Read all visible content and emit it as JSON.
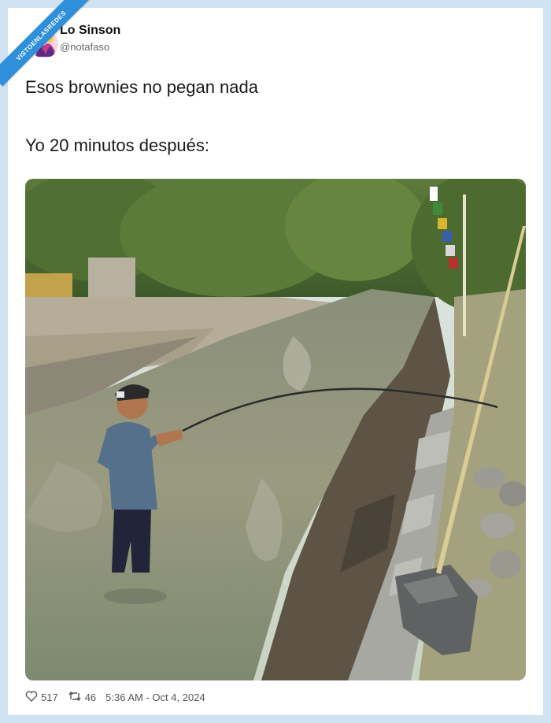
{
  "watermark": {
    "text": "VISTOENLASREDES"
  },
  "tweet": {
    "author_name": "Lo Sinson",
    "author_handle": "@notafaso",
    "line1": "Esos brownies no pegan nada",
    "line2": "Yo 20 minutos después:",
    "likes": "517",
    "retweets": "46",
    "timestamp": "5:36 AM - Oct 4, 2024"
  },
  "colors": {
    "page_background": "#cfe3f3",
    "ribbon": "#2f8fd8",
    "text": "#1a1a1a",
    "muted": "#666666"
  },
  "icons": {
    "like": "heart-icon",
    "retweet": "retweet-icon"
  }
}
